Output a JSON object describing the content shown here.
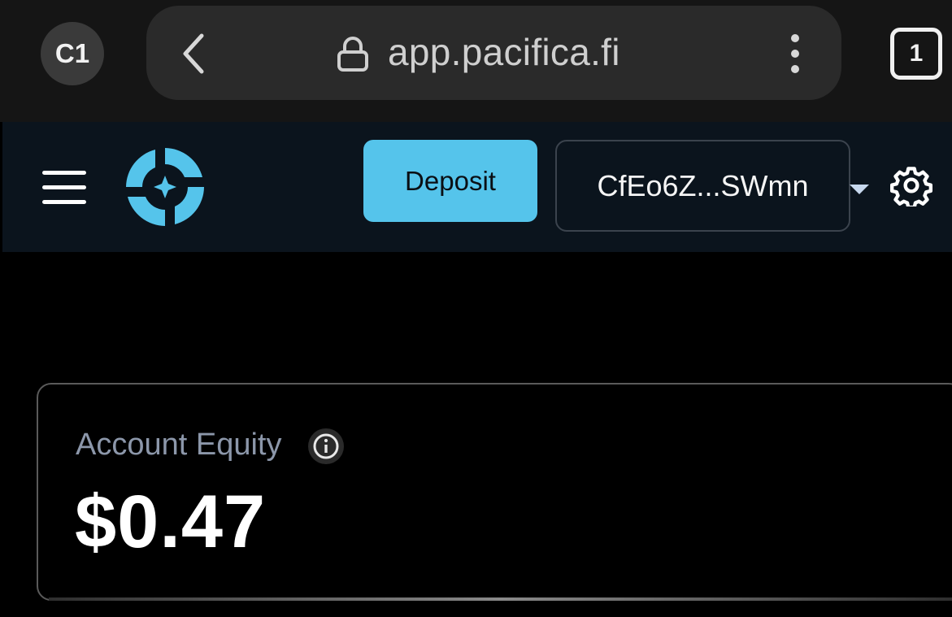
{
  "browser": {
    "profile_initials": "C1",
    "url": "app.pacifica.fi",
    "tab_count": "1",
    "icons": [
      "back-icon",
      "lock-icon",
      "more-vert-icon",
      "tabs-icon"
    ]
  },
  "header": {
    "deposit_label": "Deposit",
    "wallet_label": "CfEo6Z...SWmn",
    "accent_color": "#55c4eb",
    "icons": [
      "hamburger-icon",
      "pacifica-logo",
      "caret-down-icon",
      "gear-icon"
    ]
  },
  "account": {
    "equity_label": "Account Equity",
    "equity_value": "$0.47"
  }
}
